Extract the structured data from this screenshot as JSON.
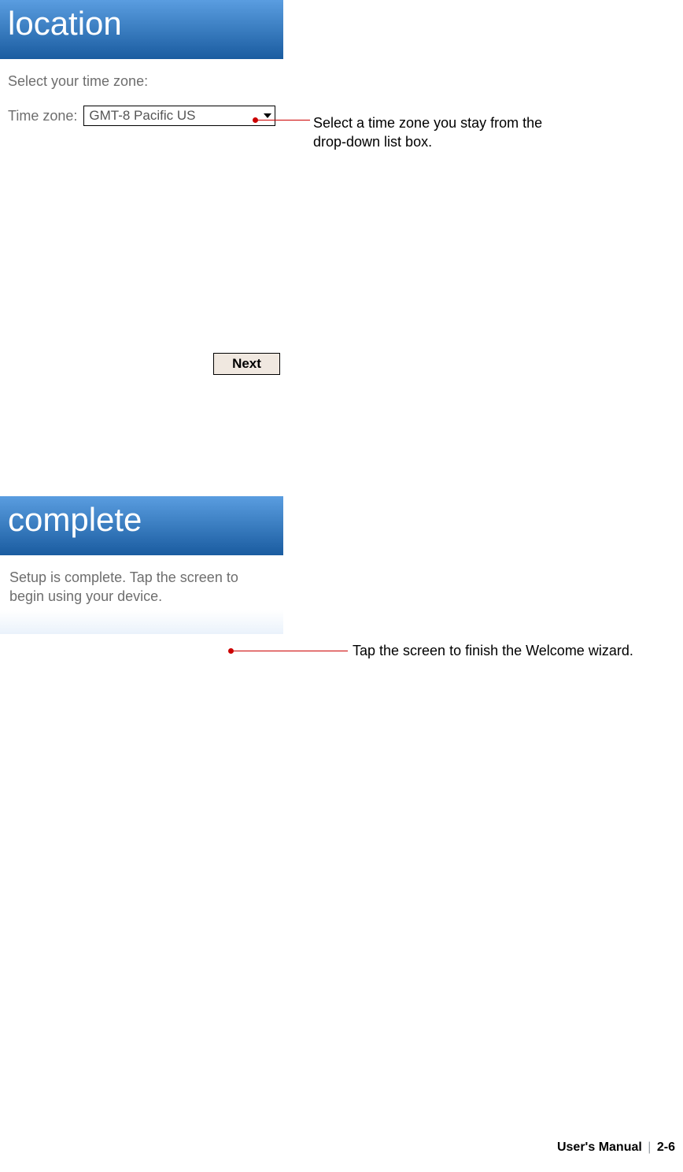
{
  "screenshot1": {
    "banner": "location",
    "instruction": "Select your time zone:",
    "timezone_label": "Time zone:",
    "timezone_value": "GMT-8 Pacific US",
    "next_button": "Next"
  },
  "screenshot2": {
    "banner": "complete",
    "message": "Setup is complete. Tap the screen to begin using your device."
  },
  "callouts": {
    "timezone": "Select a time zone you stay from the drop-down list box.",
    "tap_screen": "Tap the screen to finish the Welcome wizard."
  },
  "footer": {
    "title": "User's Manual",
    "page": "2-6"
  }
}
